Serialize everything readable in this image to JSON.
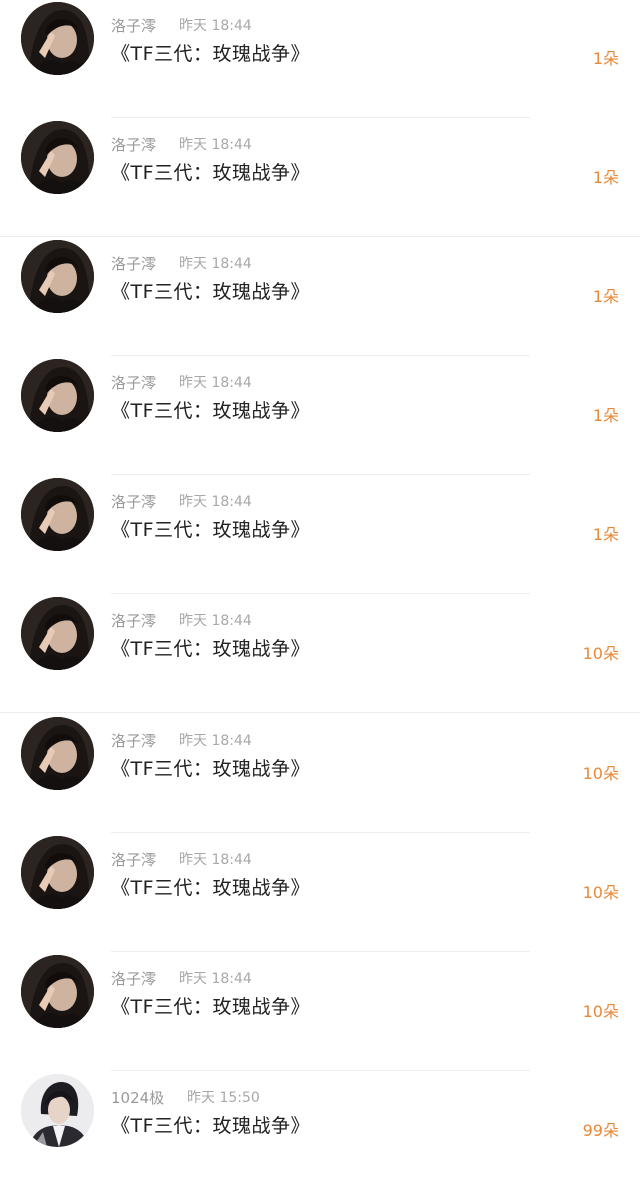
{
  "colors": {
    "name_gray": "#9a9a9a",
    "title_dark": "#222222",
    "count_orange": "#e8893a",
    "divider": "#eeeeee"
  },
  "items": [
    {
      "name": "洛子澪",
      "time": "昨天 18:44",
      "title": "《TF三代：玫瑰战争》",
      "count": "1朵",
      "avatar": "girl-avatar"
    },
    {
      "name": "洛子澪",
      "time": "昨天 18:44",
      "title": "《TF三代：玫瑰战争》",
      "count": "1朵",
      "avatar": "girl-avatar"
    },
    {
      "name": "洛子澪",
      "time": "昨天 18:44",
      "title": "《TF三代：玫瑰战争》",
      "count": "1朵",
      "avatar": "girl-avatar"
    },
    {
      "name": "洛子澪",
      "time": "昨天 18:44",
      "title": "《TF三代：玫瑰战争》",
      "count": "1朵",
      "avatar": "girl-avatar"
    },
    {
      "name": "洛子澪",
      "time": "昨天 18:44",
      "title": "《TF三代：玫瑰战争》",
      "count": "1朵",
      "avatar": "girl-avatar"
    },
    {
      "name": "洛子澪",
      "time": "昨天 18:44",
      "title": "《TF三代：玫瑰战争》",
      "count": "10朵",
      "avatar": "girl-avatar"
    },
    {
      "name": "洛子澪",
      "time": "昨天 18:44",
      "title": "《TF三代：玫瑰战争》",
      "count": "10朵",
      "avatar": "girl-avatar"
    },
    {
      "name": "洛子澪",
      "time": "昨天 18:44",
      "title": "《TF三代：玫瑰战争》",
      "count": "10朵",
      "avatar": "girl-avatar"
    },
    {
      "name": "洛子澪",
      "time": "昨天 18:44",
      "title": "《TF三代：玫瑰战争》",
      "count": "10朵",
      "avatar": "girl-avatar"
    },
    {
      "name": "1024极",
      "time": "昨天 15:50",
      "title": "《TF三代：玫瑰战争》",
      "count": "99朵",
      "avatar": "boy-avatar"
    }
  ]
}
